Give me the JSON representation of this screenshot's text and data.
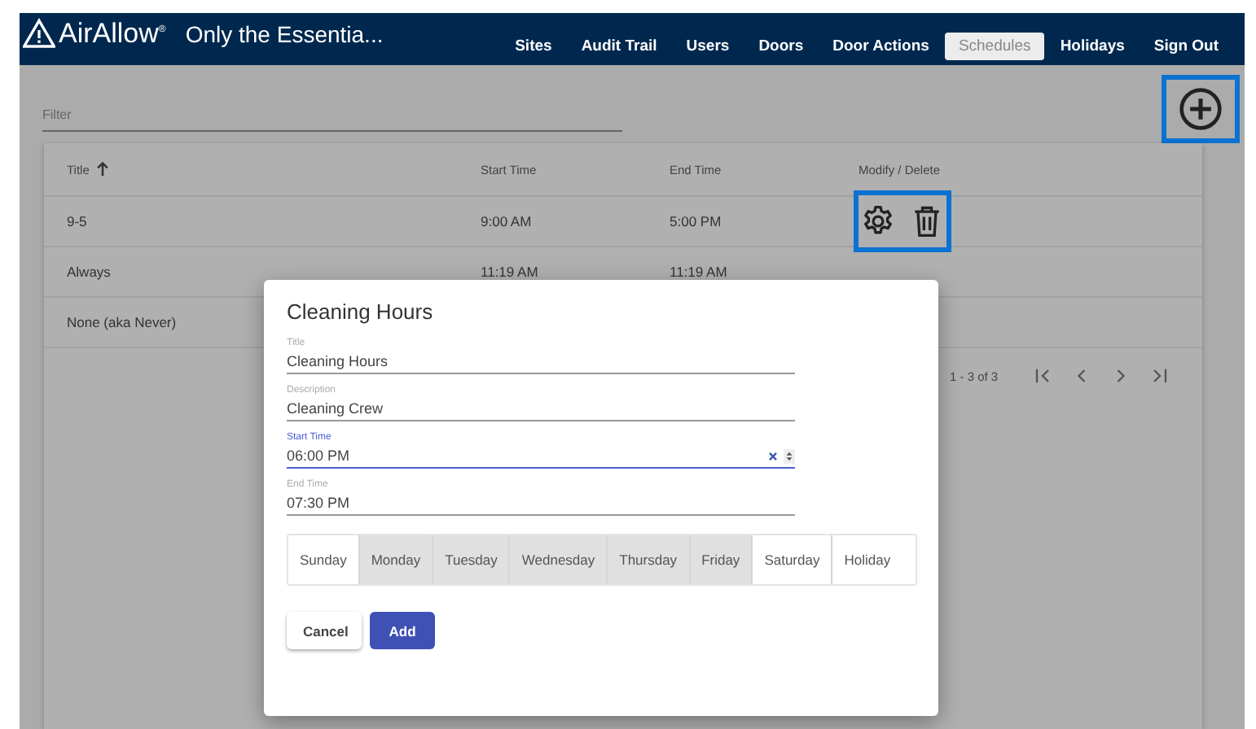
{
  "header": {
    "logo": "AirAllow$^{®}$",
    "site_name": "Only the Essentia...",
    "nav": [
      {
        "label": "Sites",
        "selected": false
      },
      {
        "label": "Audit Trail",
        "selected": false
      },
      {
        "label": "Users",
        "selected": false
      },
      {
        "label": "Doors",
        "selected": false
      },
      {
        "label": "Door Actions",
        "selected": false
      },
      {
        "label": "Schedules",
        "selected": true
      },
      {
        "label": "Holidays",
        "selected": false
      },
      {
        "label": "Sign Out",
        "selected": false
      }
    ]
  },
  "filter": {
    "placeholder": "Filter"
  },
  "table": {
    "columns": [
      {
        "label": "Title",
        "sorted": true
      },
      {
        "label": "Start Time",
        "sorted": false
      },
      {
        "label": "End Time",
        "sorted": false
      },
      {
        "label": "Modify / Delete",
        "sorted": false
      }
    ],
    "rows": [
      {
        "cells": [
          "9-5",
          "9:00 AM",
          "5:00 PM"
        ],
        "actions": true
      },
      {
        "cells": [
          "Always",
          "11:19 AM",
          "11:19 AM"
        ],
        "actions": false
      },
      {
        "cells": [
          "None (aka Never)"
        ],
        "actions": false
      }
    ],
    "pagination": "1 - 3 of 3"
  },
  "dialog": {
    "title": "Cleaning Hours",
    "fields": [
      {
        "label": "Title",
        "value": "Cleaning Hours",
        "focused": false
      },
      {
        "label": "Description",
        "value": "Cleaning Crew",
        "focused": false
      },
      {
        "label": "Start Time",
        "value": "06:00 PM",
        "focused": true
      },
      {
        "label": "End Time",
        "value": "07:30 PM",
        "focused": false
      }
    ],
    "days": [
      {
        "label": "Sunday",
        "selected": false
      },
      {
        "label": "Monday",
        "selected": true
      },
      {
        "label": "Tuesday",
        "selected": true
      },
      {
        "label": "Wednesday",
        "selected": true
      },
      {
        "label": "Thursday",
        "selected": true
      },
      {
        "label": "Friday",
        "selected": true
      },
      {
        "label": "Saturday",
        "selected": false
      },
      {
        "label": "Holiday",
        "selected": false
      }
    ],
    "buttons": [
      {
        "label": "Cancel",
        "kind": "secondary"
      },
      {
        "label": "Add",
        "kind": "primary"
      }
    ]
  }
}
